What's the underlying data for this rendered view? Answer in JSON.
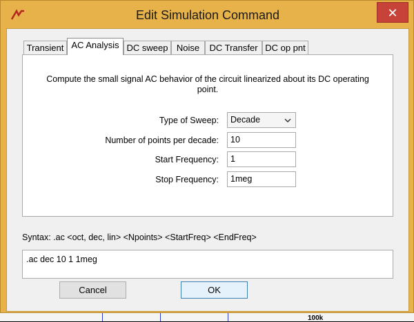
{
  "window": {
    "title": "Edit Simulation Command",
    "close_label": "✕"
  },
  "tabs": [
    {
      "label": "Transient",
      "active": false
    },
    {
      "label": "AC Analysis",
      "active": true
    },
    {
      "label": "DC sweep",
      "active": false
    },
    {
      "label": "Noise",
      "active": false
    },
    {
      "label": "DC Transfer",
      "active": false
    },
    {
      "label": "DC op pnt",
      "active": false
    }
  ],
  "panel": {
    "description": "Compute the small signal AC behavior of the circuit linearized about its DC operating point.",
    "type_of_sweep": {
      "label": "Type of Sweep:",
      "value": "Decade"
    },
    "points": {
      "label": "Number of points per decade:",
      "value": "10"
    },
    "start_freq": {
      "label": "Start Frequency:",
      "value": "1"
    },
    "stop_freq": {
      "label": "Stop Frequency:",
      "value": "1meg"
    }
  },
  "syntax": "Syntax:  .ac <oct, dec, lin> <Npoints> <StartFreq> <EndFreq>",
  "command": ".ac dec 10 1 1meg",
  "buttons": {
    "cancel": "Cancel",
    "ok": "OK"
  },
  "background": {
    "component_label": "100k"
  },
  "colors": {
    "title_bar": "#e8b24b",
    "close": "#c7433a",
    "trace": "#00c000"
  },
  "icons": {
    "app": "ltspice-icon",
    "dropdown": "chevron-down-icon"
  }
}
